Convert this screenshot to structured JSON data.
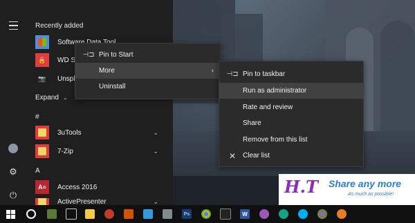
{
  "start_menu": {
    "recently_added_header": "Recently added",
    "recent_apps": [
      {
        "label": "Software Data Tool",
        "icon": "grid-app-icon",
        "color": "#4a90e2"
      },
      {
        "label": "WD Security",
        "icon": "lock-app-icon",
        "color": "#e33c3c"
      },
      {
        "label": "Unsplash Wallpapers",
        "icon": "camera-app-icon",
        "color": "#1f1f1f"
      }
    ],
    "expand_label": "Expand",
    "hash_header": "#",
    "a_header": "A",
    "apps": [
      {
        "label": "3uTools",
        "icon": "folder-icon",
        "color": "#e33c3c",
        "has_chevron": true
      },
      {
        "label": "7-Zip",
        "icon": "folder-icon",
        "color": "#e33c3c",
        "has_chevron": true
      },
      {
        "label": "Access 2016",
        "icon": "access-icon",
        "tile_text": "A≡",
        "color": "#b8262f",
        "has_chevron": false
      },
      {
        "label": "ActivePresenter",
        "icon": "folder-icon",
        "color": "#e33c3c",
        "has_chevron": true
      }
    ]
  },
  "context_menu": {
    "items": [
      {
        "label": "Pin to Start",
        "icon": "pin-icon"
      },
      {
        "label": "More",
        "icon": "",
        "submenu": true
      },
      {
        "label": "Uninstall",
        "icon": ""
      }
    ]
  },
  "submenu": {
    "items": [
      {
        "label": "Pin to taskbar",
        "icon": "pin-icon"
      },
      {
        "label": "Run as administrator",
        "icon": ""
      },
      {
        "label": "Rate and review",
        "icon": ""
      },
      {
        "label": "Share",
        "icon": ""
      },
      {
        "label": "Remove from this list",
        "icon": ""
      },
      {
        "label": "Clear list",
        "icon": "close-icon"
      }
    ]
  },
  "watermark": {
    "logo": "H.T",
    "text": "Share any more",
    "sub": "As much as possible!"
  },
  "taskbar": {
    "items": [
      "windows-logo-icon",
      "cortana-icon",
      "game-icon",
      "settings-icon",
      "file-explorer-icon",
      "flash-icon",
      "tool-icon",
      "screen-icon",
      "app-icon",
      "photoshop-icon",
      "chrome-icon",
      "word-icon",
      "design-icon",
      "settings-gear-icon",
      "skype-icon",
      "chrome2-icon",
      "app2-icon"
    ],
    "colors": {
      "photoshop": "#1b3b6f",
      "word": "#2b579a",
      "folder": "#f6c945"
    }
  }
}
